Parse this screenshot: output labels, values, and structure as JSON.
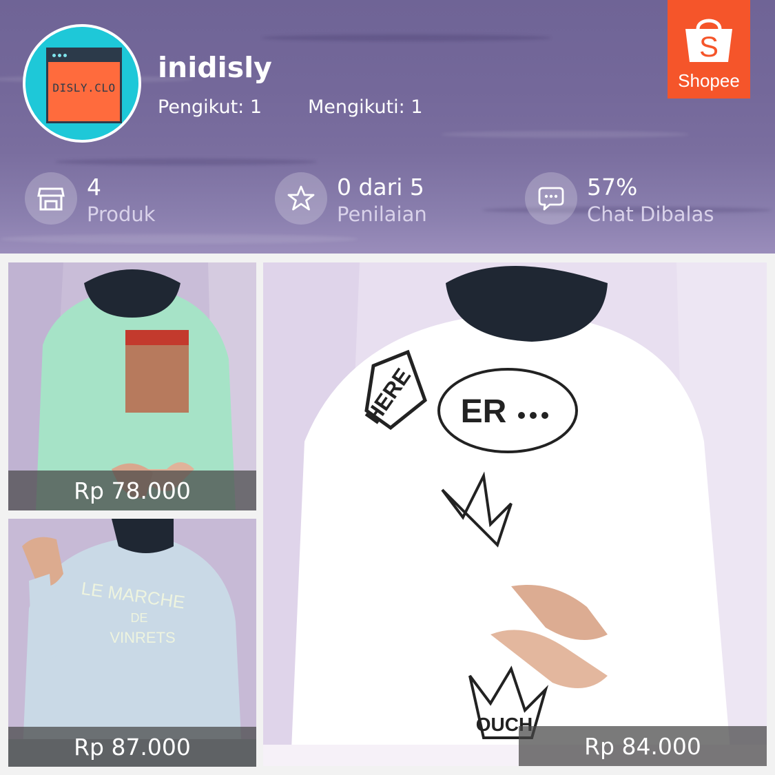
{
  "shop": {
    "avatar_text": "DISLY.CLO",
    "name": "inidisly",
    "followers": "Pengikut: 1",
    "following": "Mengikuti: 1",
    "brand": "Shopee"
  },
  "stats": [
    {
      "value": "4",
      "label": "Produk",
      "icon": "store-icon"
    },
    {
      "value": "0 dari 5",
      "label": "Penilaian",
      "icon": "star-icon"
    },
    {
      "value": "57%",
      "label": "Chat Dibalas",
      "icon": "chat-icon"
    }
  ],
  "products": [
    {
      "price": "Rp 78.000",
      "color": "#a6e3c7"
    },
    {
      "price": "Rp 87.000",
      "color": "#c9d9e6"
    },
    {
      "price": "Rp 84.000",
      "color": "#ffffff"
    }
  ],
  "colors": {
    "shopee_orange": "#f5552a",
    "avatar_teal": "#1ec8d8",
    "avatar_orange": "#ff6b3d"
  }
}
